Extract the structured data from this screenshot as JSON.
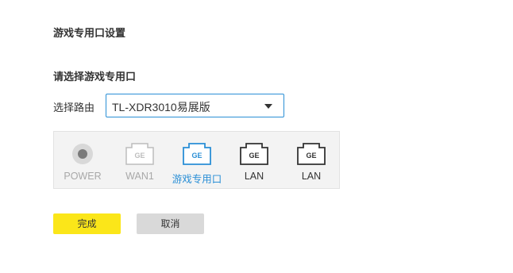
{
  "page": {
    "title": "游戏专用口设置"
  },
  "form": {
    "section_title": "请选择游戏专用口",
    "router_label": "选择路由",
    "router_value": "TL-XDR3010易展版"
  },
  "ports": [
    {
      "label": "POWER",
      "state": "disabled",
      "icon": "power-icon"
    },
    {
      "label": "WAN1",
      "icon_text": "GE",
      "state": "disabled",
      "icon": "ethernet-port-icon"
    },
    {
      "label": "游戏专用口",
      "icon_text": "GE",
      "state": "selected-game",
      "icon": "ethernet-port-icon"
    },
    {
      "label": "LAN",
      "icon_text": "GE",
      "state": "lan",
      "icon": "ethernet-port-icon"
    },
    {
      "label": "LAN",
      "icon_text": "GE",
      "state": "lan",
      "icon": "ethernet-port-icon"
    }
  ],
  "actions": {
    "done_label": "完成",
    "cancel_label": "取消"
  },
  "colors": {
    "accent": "#2a8fd6",
    "done_button": "#fbe619",
    "cancel_button": "#d9d9d9",
    "disabled": "#a8a8a8"
  }
}
